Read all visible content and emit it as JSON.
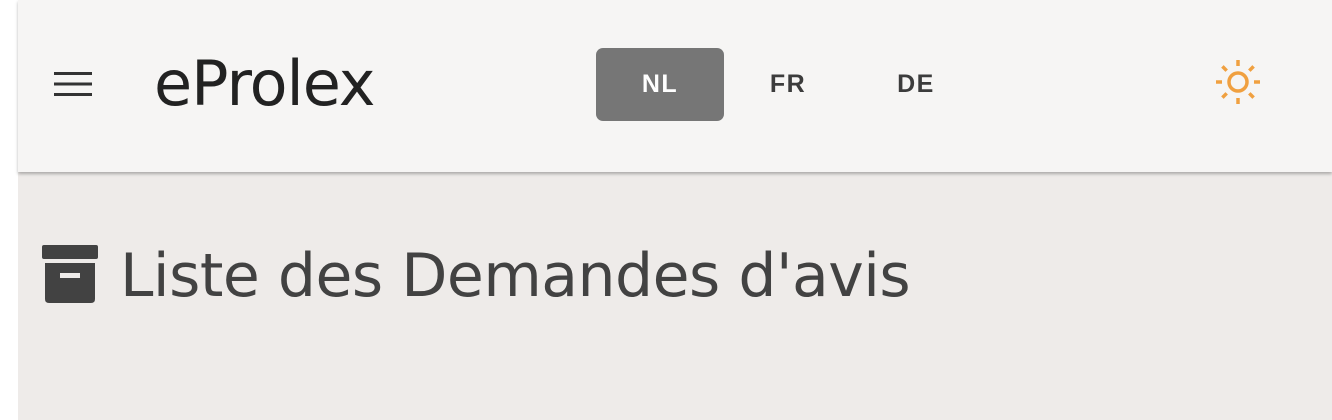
{
  "header": {
    "app_title": "eProlex",
    "menu_icon": "hamburger-menu-icon",
    "theme_icon": "sun-icon",
    "theme_icon_color": "#f0a040",
    "languages": [
      {
        "code": "NL",
        "active": true
      },
      {
        "code": "FR",
        "active": false
      },
      {
        "code": "DE",
        "active": false
      }
    ],
    "active_language_color": "#767676"
  },
  "main": {
    "title": "Liste des Demandes d'avis",
    "title_icon": "archive-box-icon"
  }
}
